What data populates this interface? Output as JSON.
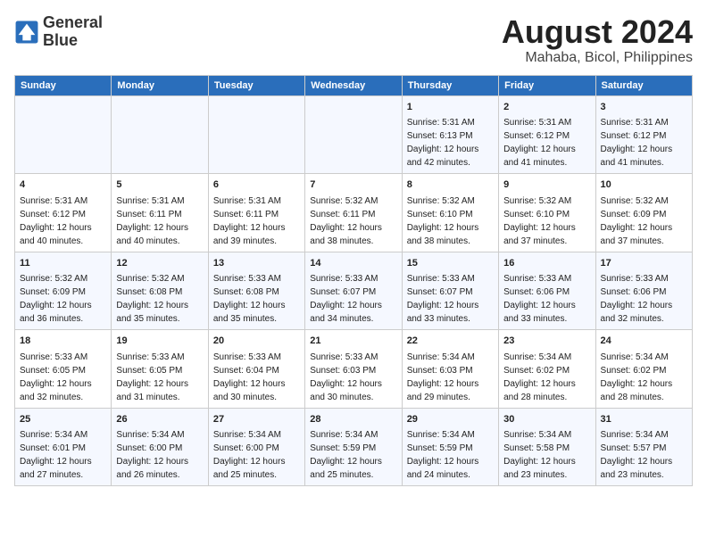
{
  "logo": {
    "line1": "General",
    "line2": "Blue"
  },
  "title": "August 2024",
  "subtitle": "Mahaba, Bicol, Philippines",
  "days_of_week": [
    "Sunday",
    "Monday",
    "Tuesday",
    "Wednesday",
    "Thursday",
    "Friday",
    "Saturday"
  ],
  "weeks": [
    [
      {
        "day": "",
        "content": ""
      },
      {
        "day": "",
        "content": ""
      },
      {
        "day": "",
        "content": ""
      },
      {
        "day": "",
        "content": ""
      },
      {
        "day": "1",
        "content": "Sunrise: 5:31 AM\nSunset: 6:13 PM\nDaylight: 12 hours\nand 42 minutes."
      },
      {
        "day": "2",
        "content": "Sunrise: 5:31 AM\nSunset: 6:12 PM\nDaylight: 12 hours\nand 41 minutes."
      },
      {
        "day": "3",
        "content": "Sunrise: 5:31 AM\nSunset: 6:12 PM\nDaylight: 12 hours\nand 41 minutes."
      }
    ],
    [
      {
        "day": "4",
        "content": "Sunrise: 5:31 AM\nSunset: 6:12 PM\nDaylight: 12 hours\nand 40 minutes."
      },
      {
        "day": "5",
        "content": "Sunrise: 5:31 AM\nSunset: 6:11 PM\nDaylight: 12 hours\nand 40 minutes."
      },
      {
        "day": "6",
        "content": "Sunrise: 5:31 AM\nSunset: 6:11 PM\nDaylight: 12 hours\nand 39 minutes."
      },
      {
        "day": "7",
        "content": "Sunrise: 5:32 AM\nSunset: 6:11 PM\nDaylight: 12 hours\nand 38 minutes."
      },
      {
        "day": "8",
        "content": "Sunrise: 5:32 AM\nSunset: 6:10 PM\nDaylight: 12 hours\nand 38 minutes."
      },
      {
        "day": "9",
        "content": "Sunrise: 5:32 AM\nSunset: 6:10 PM\nDaylight: 12 hours\nand 37 minutes."
      },
      {
        "day": "10",
        "content": "Sunrise: 5:32 AM\nSunset: 6:09 PM\nDaylight: 12 hours\nand 37 minutes."
      }
    ],
    [
      {
        "day": "11",
        "content": "Sunrise: 5:32 AM\nSunset: 6:09 PM\nDaylight: 12 hours\nand 36 minutes."
      },
      {
        "day": "12",
        "content": "Sunrise: 5:32 AM\nSunset: 6:08 PM\nDaylight: 12 hours\nand 35 minutes."
      },
      {
        "day": "13",
        "content": "Sunrise: 5:33 AM\nSunset: 6:08 PM\nDaylight: 12 hours\nand 35 minutes."
      },
      {
        "day": "14",
        "content": "Sunrise: 5:33 AM\nSunset: 6:07 PM\nDaylight: 12 hours\nand 34 minutes."
      },
      {
        "day": "15",
        "content": "Sunrise: 5:33 AM\nSunset: 6:07 PM\nDaylight: 12 hours\nand 33 minutes."
      },
      {
        "day": "16",
        "content": "Sunrise: 5:33 AM\nSunset: 6:06 PM\nDaylight: 12 hours\nand 33 minutes."
      },
      {
        "day": "17",
        "content": "Sunrise: 5:33 AM\nSunset: 6:06 PM\nDaylight: 12 hours\nand 32 minutes."
      }
    ],
    [
      {
        "day": "18",
        "content": "Sunrise: 5:33 AM\nSunset: 6:05 PM\nDaylight: 12 hours\nand 32 minutes."
      },
      {
        "day": "19",
        "content": "Sunrise: 5:33 AM\nSunset: 6:05 PM\nDaylight: 12 hours\nand 31 minutes."
      },
      {
        "day": "20",
        "content": "Sunrise: 5:33 AM\nSunset: 6:04 PM\nDaylight: 12 hours\nand 30 minutes."
      },
      {
        "day": "21",
        "content": "Sunrise: 5:33 AM\nSunset: 6:03 PM\nDaylight: 12 hours\nand 30 minutes."
      },
      {
        "day": "22",
        "content": "Sunrise: 5:34 AM\nSunset: 6:03 PM\nDaylight: 12 hours\nand 29 minutes."
      },
      {
        "day": "23",
        "content": "Sunrise: 5:34 AM\nSunset: 6:02 PM\nDaylight: 12 hours\nand 28 minutes."
      },
      {
        "day": "24",
        "content": "Sunrise: 5:34 AM\nSunset: 6:02 PM\nDaylight: 12 hours\nand 28 minutes."
      }
    ],
    [
      {
        "day": "25",
        "content": "Sunrise: 5:34 AM\nSunset: 6:01 PM\nDaylight: 12 hours\nand 27 minutes."
      },
      {
        "day": "26",
        "content": "Sunrise: 5:34 AM\nSunset: 6:00 PM\nDaylight: 12 hours\nand 26 minutes."
      },
      {
        "day": "27",
        "content": "Sunrise: 5:34 AM\nSunset: 6:00 PM\nDaylight: 12 hours\nand 25 minutes."
      },
      {
        "day": "28",
        "content": "Sunrise: 5:34 AM\nSunset: 5:59 PM\nDaylight: 12 hours\nand 25 minutes."
      },
      {
        "day": "29",
        "content": "Sunrise: 5:34 AM\nSunset: 5:59 PM\nDaylight: 12 hours\nand 24 minutes."
      },
      {
        "day": "30",
        "content": "Sunrise: 5:34 AM\nSunset: 5:58 PM\nDaylight: 12 hours\nand 23 minutes."
      },
      {
        "day": "31",
        "content": "Sunrise: 5:34 AM\nSunset: 5:57 PM\nDaylight: 12 hours\nand 23 minutes."
      }
    ]
  ]
}
